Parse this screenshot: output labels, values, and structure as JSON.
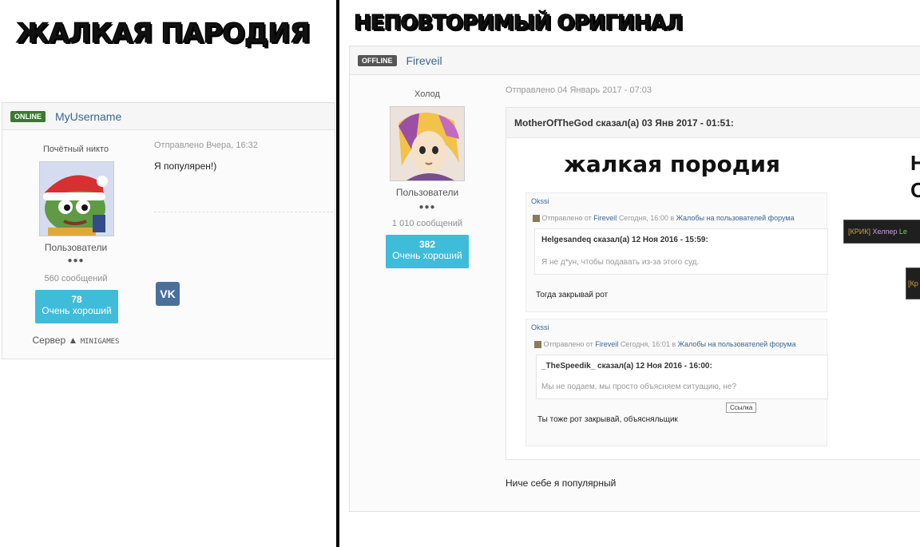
{
  "left": {
    "caption": "ЖАЛКАЯ ПАРОДИЯ",
    "status": "ONLINE",
    "username": "MyUsername",
    "title": "Почётный никто",
    "group": "Пользователи",
    "posts": "560 сообщений",
    "rep_value": "78",
    "rep_label": "Очень хороший",
    "server_label": "Сервер",
    "server_name": "MINIGAMES",
    "posted": "Отправлено Вчера, 16:32",
    "message": "Я популярен!)",
    "vk": "VK"
  },
  "right": {
    "caption": "НЕПОВТОРИМЫЙ ОРИГИНАЛ",
    "status": "OFFLINE",
    "username": "Fireveil",
    "title": "Холод",
    "group": "Пользователи",
    "posts": "1 010 сообщений",
    "rep_value": "382",
    "rep_label": "Очень хороший",
    "posted": "Отправлено 04 Январь 2017 - 07:03",
    "quote_head": "MotherOfTheGod сказал(а) 03 Янв 2017 - 01:51:",
    "message": "Ниче себе я популярный",
    "inner": {
      "title": "жалкая породия",
      "side_letters": "Н",
      "side_letters2": "О",
      "tag_label": "[КРИК]",
      "tag_user": "Хелпер",
      "tag_tail": "Le",
      "tag2": "[Кр",
      "post1": {
        "author": "Okssi",
        "posted_prefix": "Отправлено от",
        "posted_user": "Fireveil",
        "posted_time": "Сегодня, 16:00 в",
        "posted_forum": "Жалобы на пользователей форума",
        "quote_head": "Helgesandeq сказал(а) 12 Ноя 2016 - 15:59:",
        "quote_text": "Я не д*ун, чтобы подавать из-за этого суд.",
        "reply": "Тогда закрывай рот"
      },
      "post2": {
        "author": "Okssi",
        "posted_prefix": "Отправлено от",
        "posted_user": "Fireveil",
        "posted_time": "Сегодня, 16:01 в",
        "posted_forum": "Жалобы на пользователей форума",
        "quote_head": "_TheSpeedik_ сказал(а) 12 Ноя 2016 - 16:00:",
        "quote_text": "Мы не подаем, мы просто объясняем ситуацию, не?",
        "tooltip": "Ссылка",
        "reply": "Ты тоже рот закрывай, объясняльщик"
      }
    }
  },
  "colors": {
    "online": "#3a7a2f",
    "offline": "#555555",
    "rep": "#3fbcd9",
    "link": "#3d6594",
    "vk": "#4a6f9b"
  }
}
